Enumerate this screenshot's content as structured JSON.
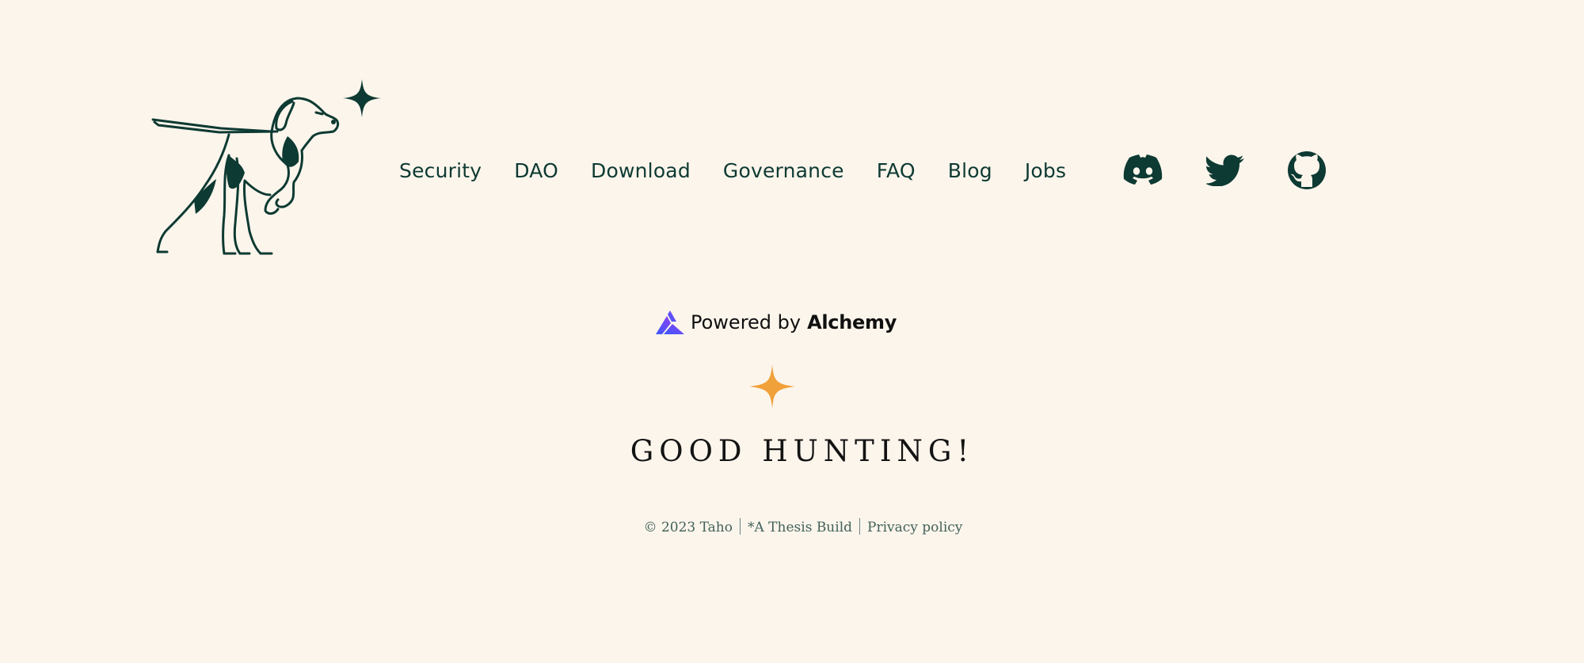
{
  "nav": {
    "items": [
      {
        "label": "Security"
      },
      {
        "label": "DAO"
      },
      {
        "label": "Download"
      },
      {
        "label": "Governance"
      },
      {
        "label": "FAQ"
      },
      {
        "label": "Blog"
      },
      {
        "label": "Jobs"
      }
    ],
    "social": [
      {
        "icon": "discord-icon"
      },
      {
        "icon": "twitter-icon"
      },
      {
        "icon": "github-icon"
      }
    ]
  },
  "powered": {
    "prefix": "Powered by",
    "brand": "Alchemy"
  },
  "tagline": "GOOD HUNTING!",
  "footer": {
    "copyright": "© 2023 Taho",
    "thesis": "*A Thesis Build",
    "privacy": "Privacy policy"
  },
  "colors": {
    "background": "#fcf5ec",
    "primary": "#0d3a32",
    "accent": "#f0a13a",
    "alchemy_blue": "#3b5bfd",
    "alchemy_purple": "#7b3ff2"
  }
}
